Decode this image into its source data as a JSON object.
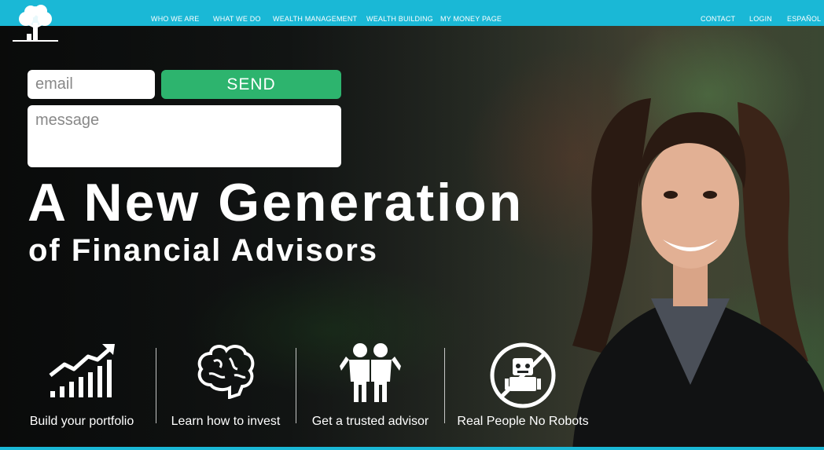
{
  "nav": {
    "left": [
      {
        "label": "WHO WE ARE"
      },
      {
        "label": "WHAT WE DO"
      },
      {
        "label": "WEALTH MANAGEMENT"
      },
      {
        "label": "WEALTH BUILDING"
      },
      {
        "label": "MY MONEY PAGE"
      }
    ],
    "right": [
      {
        "label": "CONTACT"
      },
      {
        "label": "LOGIN"
      },
      {
        "label": "ESPAÑOL"
      }
    ]
  },
  "form": {
    "email_placeholder": "email",
    "message_placeholder": "message",
    "send_label": "SEND"
  },
  "hero": {
    "headline": "A New Generation",
    "subheadline": "of Financial Advisors"
  },
  "features": [
    {
      "label": "Build your portfolio",
      "icon": "growth-chart-icon"
    },
    {
      "label": "Learn how to invest",
      "icon": "brain-icon"
    },
    {
      "label": "Get a trusted advisor",
      "icon": "two-people-icon"
    },
    {
      "label": "Real People No Robots",
      "icon": "no-robots-icon"
    }
  ],
  "colors": {
    "header": "#1ab8d6",
    "send_button": "#2db46e",
    "text": "#ffffff"
  }
}
